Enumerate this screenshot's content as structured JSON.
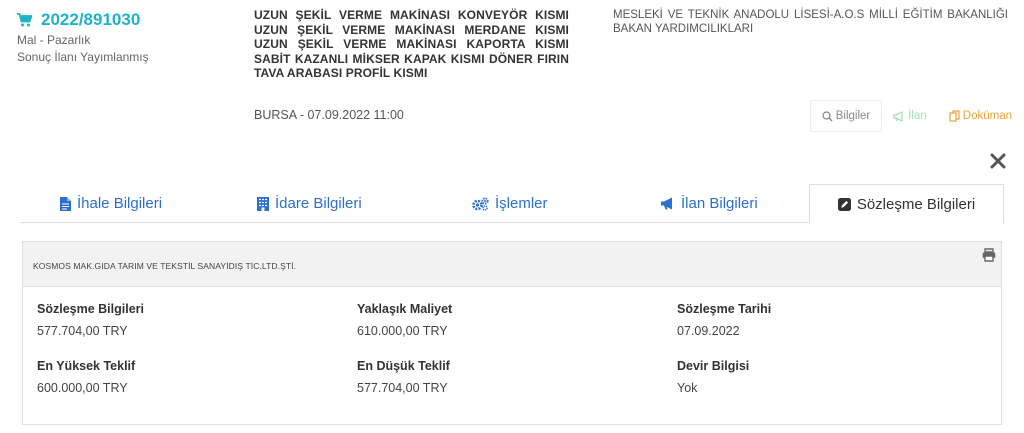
{
  "header": {
    "tender_id": "2022/891030",
    "category": "Mal - Pazarlık",
    "status": "Sonuç İlanı Yayımlanmış",
    "title": "UZUN ŞEKİL VERME MAKİNASI KONVEYÖR KISMI UZUN ŞEKİL VERME MAKİNASI MERDANE KISMI UZUN ŞEKİL VERME MAKİNASI KAPORTA KISMI SABİT KAZANLI MİKSER KAPAK KISMI DÖNER FIRIN TAVA ARABASI PROFİL KISMI",
    "place_date": "BURSA - 07.09.2022 11:00",
    "organization": "MESLEKİ VE TEKNİK ANADOLU LİSESİ-A.O.S MİLLİ EĞİTİM BAKANLIĞI BAKAN YARDIMCILIKLARI"
  },
  "actions": {
    "bilgiler": "Bilgiler",
    "ilan": "İlan",
    "dokuman": "Doküman"
  },
  "tabs": [
    {
      "label": "İhale Bilgileri",
      "icon": "file-icon"
    },
    {
      "label": "İdare Bilgileri",
      "icon": "building-icon"
    },
    {
      "label": "İşlemler",
      "icon": "gears-icon"
    },
    {
      "label": "İlan Bilgileri",
      "icon": "bullhorn-icon"
    },
    {
      "label": "Sözleşme Bilgileri",
      "icon": "edit-icon",
      "active": true
    }
  ],
  "contract": {
    "company": "KOSMOS MAK.GIDA TARIM VE TEKSTİL SANAYİDIŞ TİC.LTD.ŞTİ.",
    "fields": [
      {
        "label": "Sözleşme Bilgileri",
        "value": "577.704,00 TRY"
      },
      {
        "label": "Yaklaşık Maliyet",
        "value": "610.000,00 TRY"
      },
      {
        "label": "Sözleşme Tarihi",
        "value": "07.09.2022"
      },
      {
        "label": "En Yüksek Teklif",
        "value": "600.000,00 TRY"
      },
      {
        "label": "En Düşük Teklif",
        "value": "577.704,00 TRY"
      },
      {
        "label": "Devir Bilgisi",
        "value": "Yok"
      }
    ]
  },
  "colors": {
    "accent": "#1fb3c7",
    "tab_link": "#2d6fd0",
    "ilan_green": "#9fe0b4",
    "dokuman_orange": "#e8a23b"
  }
}
